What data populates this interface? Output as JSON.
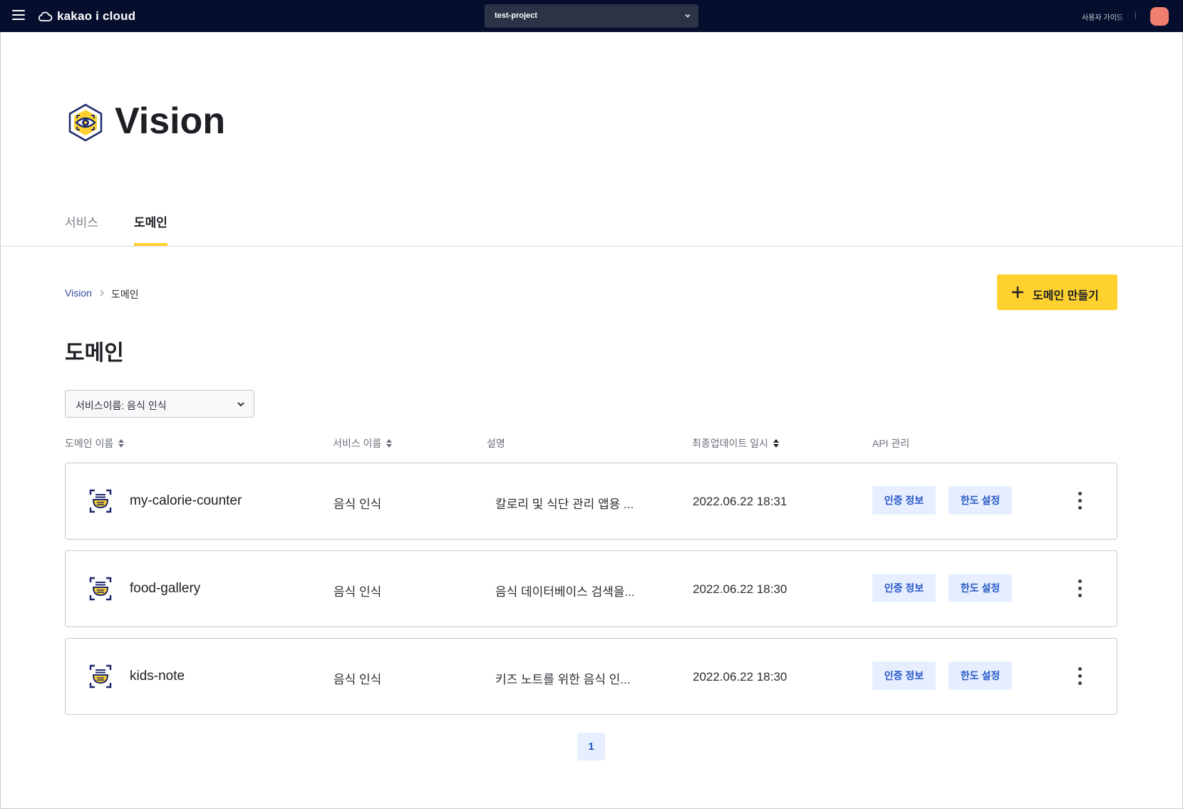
{
  "topbar": {
    "brand": "kakao i cloud",
    "project": "test-project",
    "guide_link": "사용자 가이드"
  },
  "service": {
    "title": "Vision",
    "tabs": [
      {
        "label": "서비스",
        "active": false
      },
      {
        "label": "도메인",
        "active": true
      }
    ]
  },
  "breadcrumb": {
    "root": "Vision",
    "current": "도메인"
  },
  "actions": {
    "create_label": "도메인 만들기"
  },
  "section": {
    "title": "도메인"
  },
  "filter": {
    "value": "서비스이름: 음식 인식"
  },
  "table": {
    "columns": [
      "도메인 이름",
      "서비스 이름",
      "설명",
      "최종업데이트 일시",
      "API 관리"
    ],
    "rows": [
      {
        "name": "my-calorie-counter",
        "service": "음식 인식",
        "description": "칼로리 및 식단 관리 앱용 ...",
        "updated": "2022.06.22 18:31",
        "auth_label": "인증 정보",
        "limit_label": "한도 설정"
      },
      {
        "name": "food-gallery",
        "service": "음식 인식",
        "description": "음식 데이터베이스 검색을...",
        "updated": "2022.06.22 18:30",
        "auth_label": "인증 정보",
        "limit_label": "한도 설정"
      },
      {
        "name": "kids-note",
        "service": "음식 인식",
        "description": "키즈 노트를 위한 음식 인...",
        "updated": "2022.06.22 18:30",
        "auth_label": "인증 정보",
        "limit_label": "한도 설정"
      }
    ]
  },
  "pagination": {
    "current": "1"
  },
  "colors": {
    "topbar": "#050f2d",
    "accent_yellow": "#fed12f",
    "pill_bg": "#e6eeff",
    "pill_text": "#2758c7",
    "avatar": "#ef7f6f"
  },
  "icons": [
    "menu-icon",
    "cloud-logo-icon",
    "chevron-down-icon",
    "vision-eye-icon",
    "plus-icon",
    "sort-icon",
    "food-bowl-icon",
    "more-vert-icon"
  ]
}
